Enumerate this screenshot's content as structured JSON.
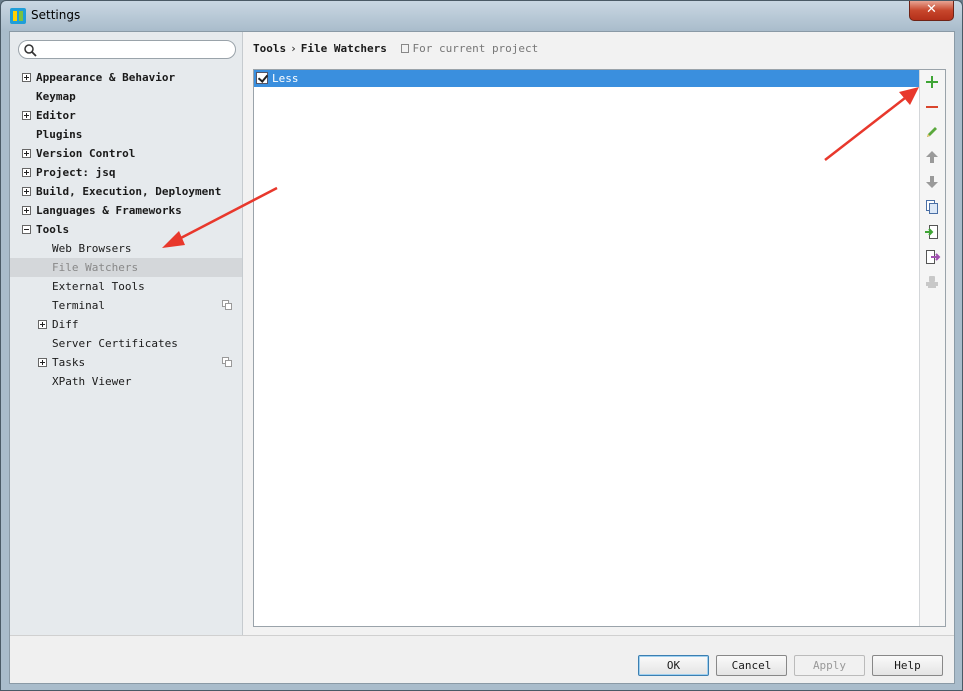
{
  "window": {
    "title": "Settings",
    "close_glyph": "✕"
  },
  "search": {
    "placeholder": "",
    "value": ""
  },
  "sidebar": {
    "items": [
      {
        "label": "Appearance & Behavior",
        "expander": "plus"
      },
      {
        "label": "Keymap"
      },
      {
        "label": "Editor",
        "expander": "plus"
      },
      {
        "label": "Plugins"
      },
      {
        "label": "Version Control",
        "expander": "plus"
      },
      {
        "label": "Project: jsq",
        "expander": "plus"
      },
      {
        "label": "Build, Execution, Deployment",
        "expander": "plus"
      },
      {
        "label": "Languages & Frameworks",
        "expander": "plus"
      },
      {
        "label": "Tools",
        "expander": "minus"
      },
      {
        "label": "Web Browsers"
      },
      {
        "label": "File Watchers",
        "selected": true
      },
      {
        "label": "External Tools"
      },
      {
        "label": "Terminal",
        "project_icon": "copy-icon"
      },
      {
        "label": "Diff",
        "expander": "plus"
      },
      {
        "label": "Server Certificates"
      },
      {
        "label": "Tasks",
        "expander": "plus",
        "project_icon": "copy-icon"
      },
      {
        "label": "XPath Viewer"
      }
    ]
  },
  "breadcrumb": {
    "part1": "Tools",
    "separator": "›",
    "part2": "File Watchers",
    "scope": "For current project"
  },
  "watchers": [
    {
      "label": "Less",
      "checked": true
    }
  ],
  "toolbar_icons": [
    "add-icon",
    "remove-icon",
    "edit-icon",
    "move-up-icon",
    "move-down-icon",
    "copy-icon",
    "import-icon",
    "export-icon",
    "stamp-icon"
  ],
  "buttons": {
    "ok": "OK",
    "cancel": "Cancel",
    "apply": "Apply",
    "help": "Help"
  },
  "colors": {
    "selection": "#3a8fde",
    "add": "#3fa535",
    "remove": "#d9452c",
    "annotation_arrow": "#e8382c"
  }
}
